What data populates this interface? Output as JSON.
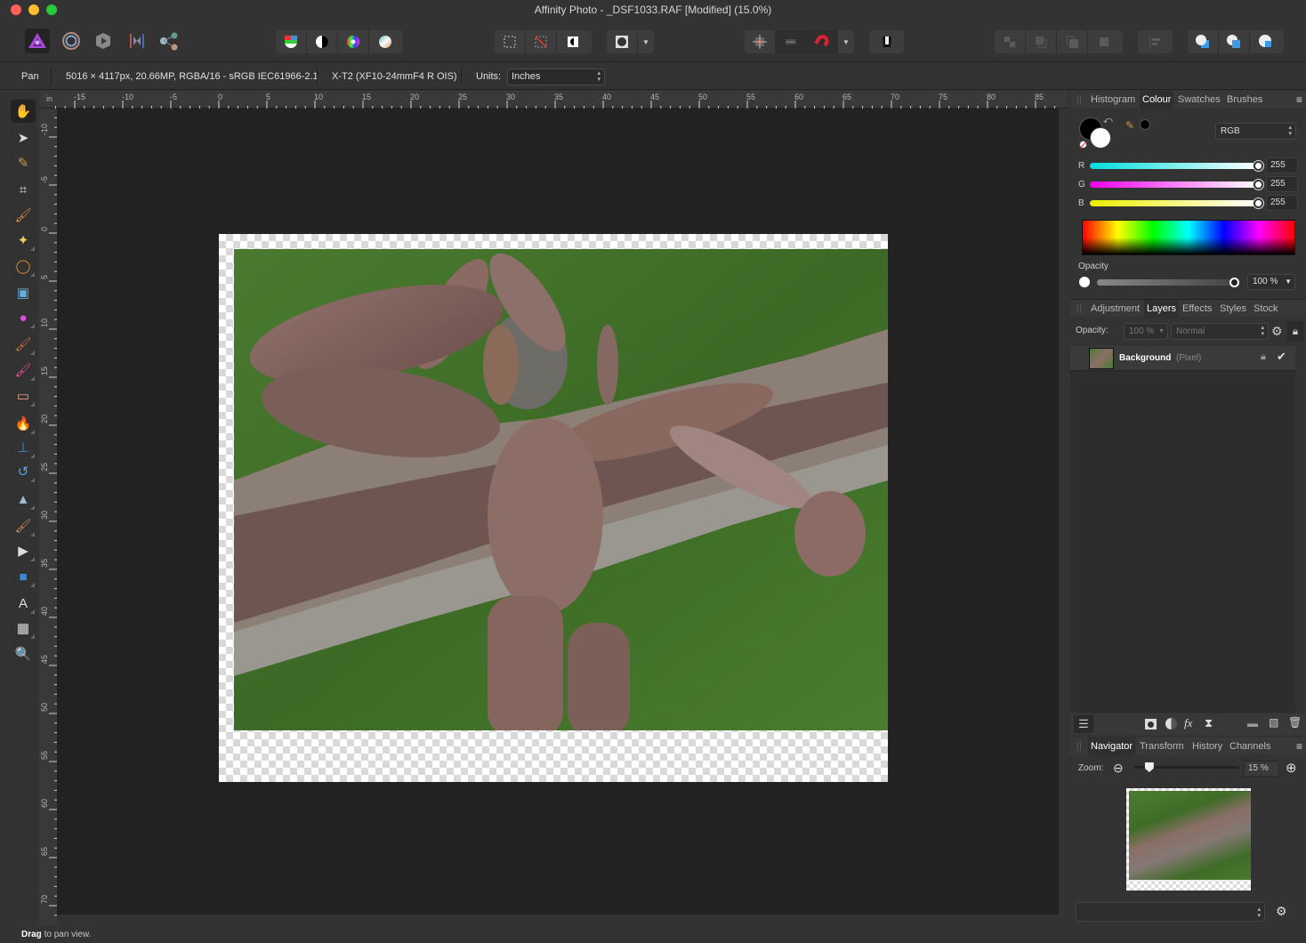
{
  "window": {
    "title": "Affinity Photo - _DSF1033.RAF [Modified] (15.0%)",
    "traffic_lights": {
      "close": "#fe5f57",
      "minimize": "#febc2e",
      "zoom": "#28c840"
    }
  },
  "toolbar": {
    "personas": [
      {
        "name": "photo-persona",
        "icon": "affinity-photo-icon",
        "active": true
      },
      {
        "name": "liquify-persona",
        "icon": "liquify-icon"
      },
      {
        "name": "develop-persona",
        "icon": "develop-icon"
      },
      {
        "name": "tone-mapping-persona",
        "icon": "tone-mapping-icon"
      },
      {
        "name": "export-persona",
        "icon": "share-icon"
      }
    ],
    "adjust_buttons": [
      "auto-levels-icon",
      "auto-contrast-icon",
      "auto-colour-icon",
      "auto-white-balance-icon"
    ],
    "selection_buttons": [
      "select-all-icon",
      "deselect-icon",
      "invert-selection-icon"
    ],
    "quick_mask": "quick-mask-icon",
    "snapping_buttons": [
      "snapping-grid-icon",
      "snap-force-icon",
      "snapping-magnet-icon"
    ],
    "assistant": "assistant-icon",
    "arrange_buttons": [
      "move-to-back-icon",
      "move-back-one-icon",
      "move-forward-one-icon",
      "move-to-front-icon"
    ],
    "align": "align-left-icon",
    "boolean_buttons": [
      "add-icon",
      "subtract-icon",
      "intersect-icon"
    ]
  },
  "context": {
    "tool": "Pan",
    "doc_info": "5016 × 4117px, 20.66MP, RGBA/16 - sRGB IEC61966-2.1",
    "camera": "X-T2 (XF10-24mmF4 R OIS)",
    "units_label": "Units:",
    "units_value": "Inches"
  },
  "tools": [
    {
      "name": "view-tool",
      "icon": "hand-icon",
      "glyph": "✋",
      "active": true
    },
    {
      "name": "move-tool",
      "icon": "pointer-icon",
      "glyph": "➤"
    },
    {
      "name": "colour-picker-tool",
      "icon": "eyedropper-icon",
      "glyph": "✎"
    },
    {
      "name": "crop-tool",
      "icon": "crop-icon",
      "glyph": "⌗"
    },
    {
      "name": "selection-brush-tool",
      "icon": "selection-brush-icon",
      "glyph": "🖌"
    },
    {
      "name": "flood-select-tool",
      "icon": "magic-wand-icon",
      "glyph": "✦"
    },
    {
      "name": "freehand-selection-tool",
      "icon": "lasso-icon",
      "glyph": "◯"
    },
    {
      "name": "flood-fill-tool",
      "icon": "paint-bucket-icon",
      "glyph": "▣"
    },
    {
      "name": "colour-wheel-tool",
      "icon": "colour-wheel-icon",
      "glyph": "●"
    },
    {
      "name": "paint-brush-tool",
      "icon": "paint-brush-icon",
      "glyph": "🖌"
    },
    {
      "name": "colour-replacement-tool",
      "icon": "colour-replacement-icon",
      "glyph": "🖌"
    },
    {
      "name": "erase-brush-tool",
      "icon": "eraser-icon",
      "glyph": "▭"
    },
    {
      "name": "dodge-brush-tool",
      "icon": "flame-icon",
      "glyph": "🔥"
    },
    {
      "name": "clone-brush-tool",
      "icon": "stamp-icon",
      "glyph": "⊥"
    },
    {
      "name": "undo-brush-tool",
      "icon": "undo-brush-icon",
      "glyph": "↺"
    },
    {
      "name": "blur-brush-tool",
      "icon": "blur-cone-icon",
      "glyph": "▲"
    },
    {
      "name": "inpainting-brush-tool",
      "icon": "inpainting-icon",
      "glyph": "🖌"
    },
    {
      "name": "node-tool",
      "icon": "node-arrow-icon",
      "glyph": "▶"
    },
    {
      "name": "rectangle-tool",
      "icon": "rectangle-icon",
      "glyph": "■"
    },
    {
      "name": "artistic-text-tool",
      "icon": "text-icon",
      "glyph": "A"
    },
    {
      "name": "mesh-warp-tool",
      "icon": "mesh-warp-icon",
      "glyph": "▦"
    },
    {
      "name": "zoom-tool",
      "icon": "magnifier-icon",
      "glyph": "🔍"
    }
  ],
  "rulers": {
    "unit": "in",
    "horizontal_labels": [
      "-15",
      "-10",
      "-5",
      "0",
      "5",
      "10",
      "15",
      "20",
      "25",
      "30",
      "35",
      "40",
      "45",
      "50",
      "55",
      "60",
      "65",
      "70",
      "75",
      "80",
      "85"
    ],
    "vertical_labels": [
      "-10",
      "-5",
      "0",
      "5",
      "10",
      "15",
      "20",
      "25",
      "30",
      "35",
      "40",
      "45",
      "50",
      "55",
      "60",
      "65",
      "70"
    ]
  },
  "status": {
    "bold": "Drag",
    "rest": " to pan view."
  },
  "colour_panel": {
    "tabs": [
      "Histogram",
      "Colour",
      "Swatches",
      "Brushes"
    ],
    "active_tab": "Colour",
    "mode": "RGB",
    "channels": [
      {
        "label": "R",
        "value": "255",
        "fraction": 1.0
      },
      {
        "label": "G",
        "value": "255",
        "fraction": 1.0
      },
      {
        "label": "B",
        "value": "255",
        "fraction": 1.0
      }
    ],
    "opacity_label": "Opacity",
    "opacity_value": "100 %",
    "opacity_fraction": 1.0
  },
  "layers_panel": {
    "tabs": [
      "Adjustment",
      "Layers",
      "Effects",
      "Styles",
      "Stock"
    ],
    "active_tab": "Layers",
    "opacity_label": "Opacity:",
    "opacity_value": "100 %",
    "blend_mode": "Normal",
    "layers": [
      {
        "name": "Background",
        "type": "(Pixel)",
        "locked": true,
        "visible": true
      }
    ],
    "footer_buttons": [
      "layers-stack-icon",
      "mask-layer-icon",
      "adjustment-icon",
      "fx-icon",
      "live-filter-icon",
      "group-folder-icon",
      "new-pixel-layer-icon",
      "trash-icon"
    ]
  },
  "navigator_panel": {
    "tabs": [
      "Navigator",
      "Transform",
      "History",
      "Channels"
    ],
    "active_tab": "Navigator",
    "zoom_label": "Zoom:",
    "zoom_value": "15 %",
    "zoom_fraction": 0.15,
    "view_preset": ""
  }
}
